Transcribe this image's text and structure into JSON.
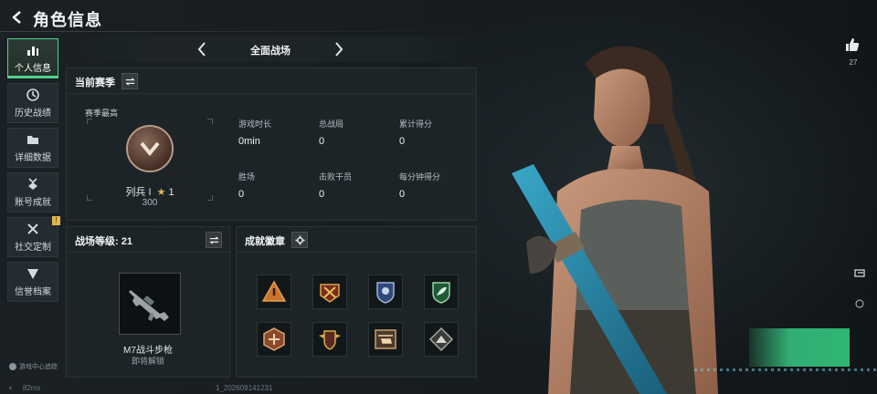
{
  "header": {
    "back_icon": "arrow-left-icon",
    "title": "角色信息"
  },
  "mode_selector": {
    "label": "全面战场",
    "prev_icon": "chevron-left-icon",
    "next_icon": "chevron-right-icon"
  },
  "sidebar": {
    "items": [
      {
        "label": "个人信息",
        "icon": "bar-chart-icon",
        "active": true
      },
      {
        "label": "历史战绩",
        "icon": "clock-icon"
      },
      {
        "label": "详细数据",
        "icon": "folder-icon"
      },
      {
        "label": "账号成就",
        "icon": "medal-icon"
      },
      {
        "label": "社交定制",
        "icon": "tools-icon",
        "badge": "!"
      },
      {
        "label": "信誉档案",
        "icon": "shield-icon"
      }
    ]
  },
  "season_panel": {
    "title": "当前赛季",
    "season_best_label": "赛季最高",
    "rank_name": "列兵 I",
    "rank_stars": "1",
    "rank_score": "300",
    "stats": [
      {
        "label": "游戏时长",
        "value": "0min"
      },
      {
        "label": "总战局",
        "value": "0"
      },
      {
        "label": "累计得分",
        "value": "0"
      },
      {
        "label": "胜场",
        "value": "0"
      },
      {
        "label": "击败干员",
        "value": "0"
      },
      {
        "label": "每分钟得分",
        "value": "0"
      }
    ]
  },
  "level_panel": {
    "title": "战场等级: 21",
    "weapon_name": "M7战斗步枪",
    "weapon_status": "即将解锁"
  },
  "achievement_panel": {
    "title": "成就徽章",
    "badges": [
      "warning-triangle-icon",
      "crossed-arrows-emblem-icon",
      "police-shield-icon",
      "leaf-shield-icon",
      "hexagon-emblem-icon",
      "winged-shield-icon",
      "helicopter-icon",
      "mountain-triangle-icon"
    ]
  },
  "right_panel": {
    "like_icon": "thumbs-up-icon",
    "like_count": "27"
  },
  "footer": {
    "game_center_text": "游戏中心追踪",
    "latency": "82ms",
    "uid_text": "1_202609141231"
  },
  "colors": {
    "accent": "#4fd28a",
    "star": "#e0b94a",
    "panel": "#1e2529"
  }
}
